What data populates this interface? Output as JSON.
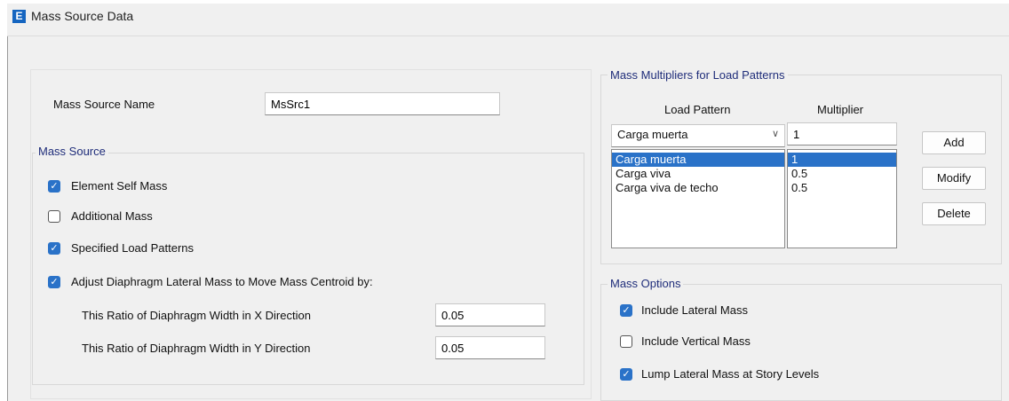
{
  "window": {
    "title": "Mass Source Data",
    "app_icon": "E"
  },
  "mass_source_name": {
    "label": "Mass Source Name",
    "value": "MsSrc1"
  },
  "mass_source": {
    "legend": "Mass Source",
    "element_self_mass": {
      "label": "Element Self Mass",
      "checked": true
    },
    "additional_mass": {
      "label": "Additional Mass",
      "checked": false
    },
    "specified_load_patterns": {
      "label": "Specified Load Patterns",
      "checked": true
    },
    "adjust_diaphragm": {
      "label": "Adjust Diaphragm Lateral Mass to Move Mass Centroid by:",
      "checked": true
    },
    "ratio_x": {
      "label": "This Ratio of Diaphragm Width in X Direction",
      "value": "0.05"
    },
    "ratio_y": {
      "label": "This Ratio of Diaphragm Width in Y Direction",
      "value": "0.05"
    }
  },
  "multipliers": {
    "legend": "Mass Multipliers for Load Patterns",
    "col_load_pattern": "Load Pattern",
    "col_multiplier": "Multiplier",
    "selected_pattern": "Carga muerta",
    "multiplier_value": "1",
    "rows": [
      {
        "pattern": "Carga muerta",
        "multiplier": "1"
      },
      {
        "pattern": "Carga viva",
        "multiplier": "0.5"
      },
      {
        "pattern": "Carga viva de techo",
        "multiplier": "0.5"
      }
    ],
    "add_label": "Add",
    "modify_label": "Modify",
    "delete_label": "Delete"
  },
  "mass_options": {
    "legend": "Mass Options",
    "include_lateral": {
      "label": "Include Lateral Mass",
      "checked": true
    },
    "include_vertical": {
      "label": "Include Vertical Mass",
      "checked": false
    },
    "lump_lateral": {
      "label": "Lump Lateral Mass at Story Levels",
      "checked": true
    }
  },
  "colors": {
    "accent": "#2a72c8",
    "legend_text": "#1f2d7a",
    "background": "#f0f0f0"
  }
}
